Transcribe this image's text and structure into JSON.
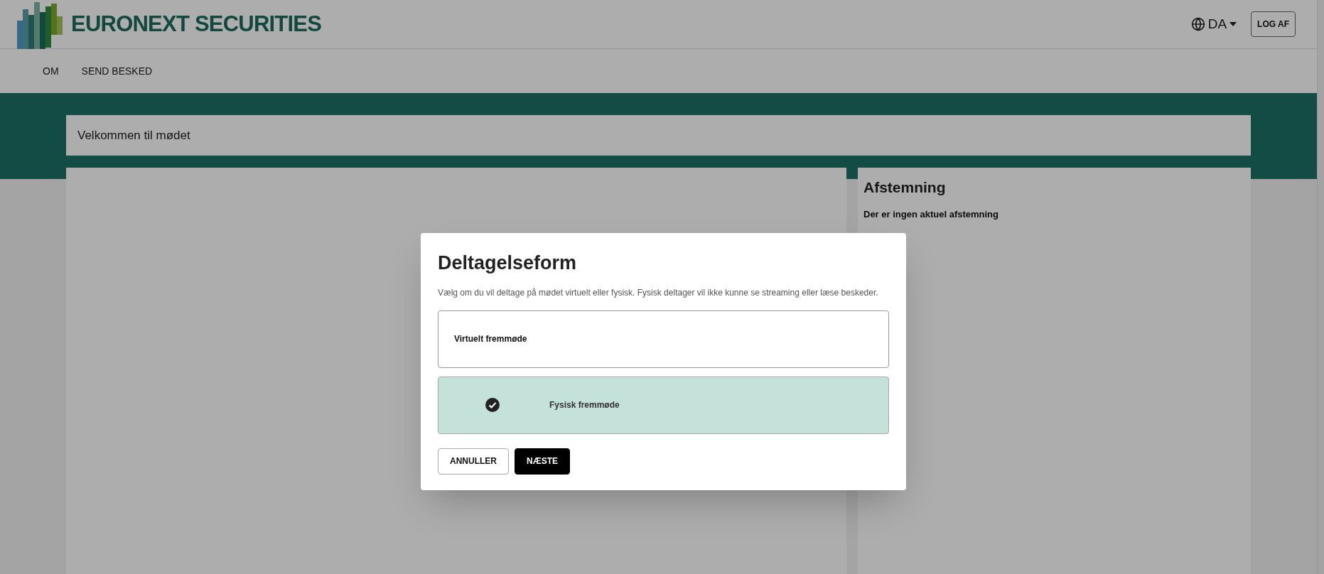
{
  "header": {
    "brand": "EURONEXT SECURITIES",
    "language": "DA",
    "logout_button": "LOG AF"
  },
  "nav": [
    {
      "label": "OM"
    },
    {
      "label": "SEND BESKED"
    }
  ],
  "welcome": "Velkommen til mødet",
  "voting_panel": {
    "title": "Afstemning",
    "message": "Der er ingen aktuel afstemning"
  },
  "dialog": {
    "title": "Deltagelseform",
    "description": "Vælg om du vil deltage på mødet virtuelt eller fysisk. Fysisk deltager vil ikke kunne se streaming eller læse beskeder.",
    "options": [
      {
        "label": "Virtuelt fremmøde",
        "selected": false
      },
      {
        "label": "Fysisk fremmøde",
        "selected": true
      }
    ],
    "buttons": [
      {
        "label": "ANNULLER",
        "kind": "secondary"
      },
      {
        "label": "NÆSTE",
        "kind": "primary"
      }
    ]
  }
}
